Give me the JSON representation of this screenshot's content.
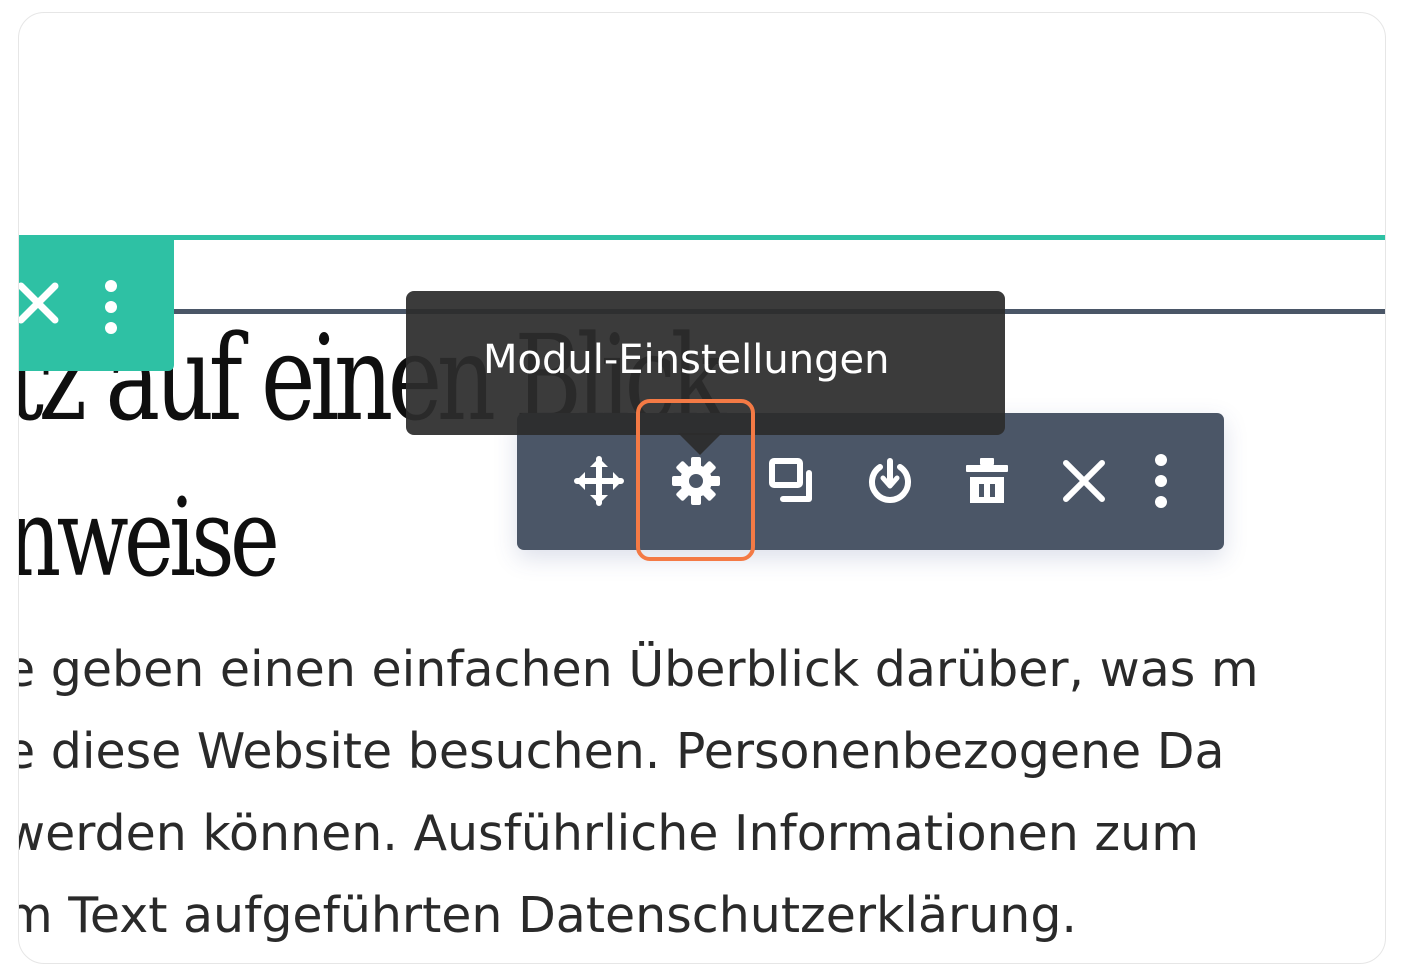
{
  "heading": {
    "line1": "tz auf einen Blick",
    "line2": "nweise"
  },
  "body": {
    "lines": [
      "e geben einen einfachen Überblick darüber, was m",
      "e diese Website besuchen. Personenbezogene Da",
      "werden können. Ausführliche Informationen zum",
      "m Text aufgeführten Datenschutzerklärung."
    ]
  },
  "tooltip": {
    "text": "Modul-Einstellungen"
  },
  "row_toolbar": {
    "icons": [
      "close-icon",
      "more-vertical-icon"
    ]
  },
  "module_toolbar": {
    "icons": [
      "move-icon",
      "gear-icon",
      "duplicate-icon",
      "power-icon",
      "trash-icon",
      "close-icon",
      "more-vertical-icon"
    ]
  },
  "colors": {
    "accent_teal": "#2ec1a4",
    "toolbar_dark": "#4b5667",
    "tooltip_bg": "#2c2c2c",
    "highlight": "#f47a45"
  }
}
